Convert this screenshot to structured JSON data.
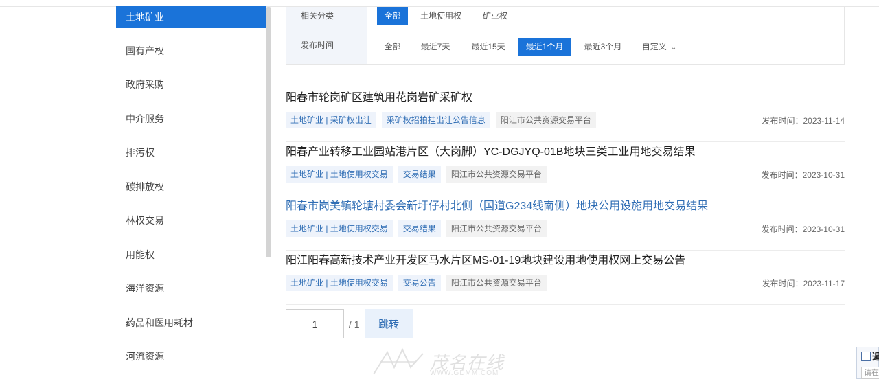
{
  "sidebar": {
    "items": [
      {
        "label": "土地矿业",
        "active": true
      },
      {
        "label": "国有产权"
      },
      {
        "label": "政府采购"
      },
      {
        "label": "中介服务"
      },
      {
        "label": "排污权"
      },
      {
        "label": "碳排放权"
      },
      {
        "label": "林权交易"
      },
      {
        "label": "用能权"
      },
      {
        "label": "海洋资源"
      },
      {
        "label": "药品和医用耗材"
      },
      {
        "label": "河流资源"
      }
    ]
  },
  "filter": {
    "category_label": "相关分类",
    "category_options": [
      "全部",
      "土地使用权",
      "矿业权"
    ],
    "category_selected": "全部",
    "time_label": "发布时间",
    "time_options": [
      "全部",
      "最近7天",
      "最近15天",
      "最近1个月",
      "最近3个月",
      "自定义"
    ],
    "time_selected": "最近1个月"
  },
  "results": [
    {
      "title": "阳春市轮岗矿区建筑用花岗岩矿采矿权",
      "tags": [
        "土地矿业 | 采矿权出让",
        "采矿权招拍挂出让公告信息",
        "阳江市公共资源交易平台"
      ],
      "date": "发布时间：2023-11-14"
    },
    {
      "title": "阳春产业转移工业园站港片区（大岗脚）YC-DGJYQ-01B地块三类工业用地交易结果",
      "tags": [
        "土地矿业 | 土地使用权交易",
        "交易结果",
        "阳江市公共资源交易平台"
      ],
      "date": "发布时间：2023-10-31"
    },
    {
      "title": "阳春市岗美镇轮塘村委会新圩仔村北侧（国道G234线南侧）地块公用设施用地交易结果",
      "tags": [
        "土地矿业 | 土地使用权交易",
        "交易结果",
        "阳江市公共资源交易平台"
      ],
      "date": "发布时间：2023-10-31"
    },
    {
      "title": "阳江阳春高新技术产业开发区马水片区MS-01-19地块建设用地使用权网上交易公告",
      "tags": [
        "土地矿业 | 土地使用权交易",
        "交易公告",
        "阳江市公共资源交易平台"
      ],
      "date": "发布时间：2023-11-17"
    }
  ],
  "pagination": {
    "current": "1",
    "total": "/ 1",
    "jump_label": "跳转"
  },
  "watermark": {
    "text": "茂名在线",
    "url": "WWW.GDMM.COM"
  },
  "corner_widget": {
    "title": "遁",
    "input_placeholder": "请在"
  },
  "colors": {
    "accent": "#1a73d9",
    "tag_text": "#2f6db4",
    "tag_bg": "#eef3fb"
  }
}
